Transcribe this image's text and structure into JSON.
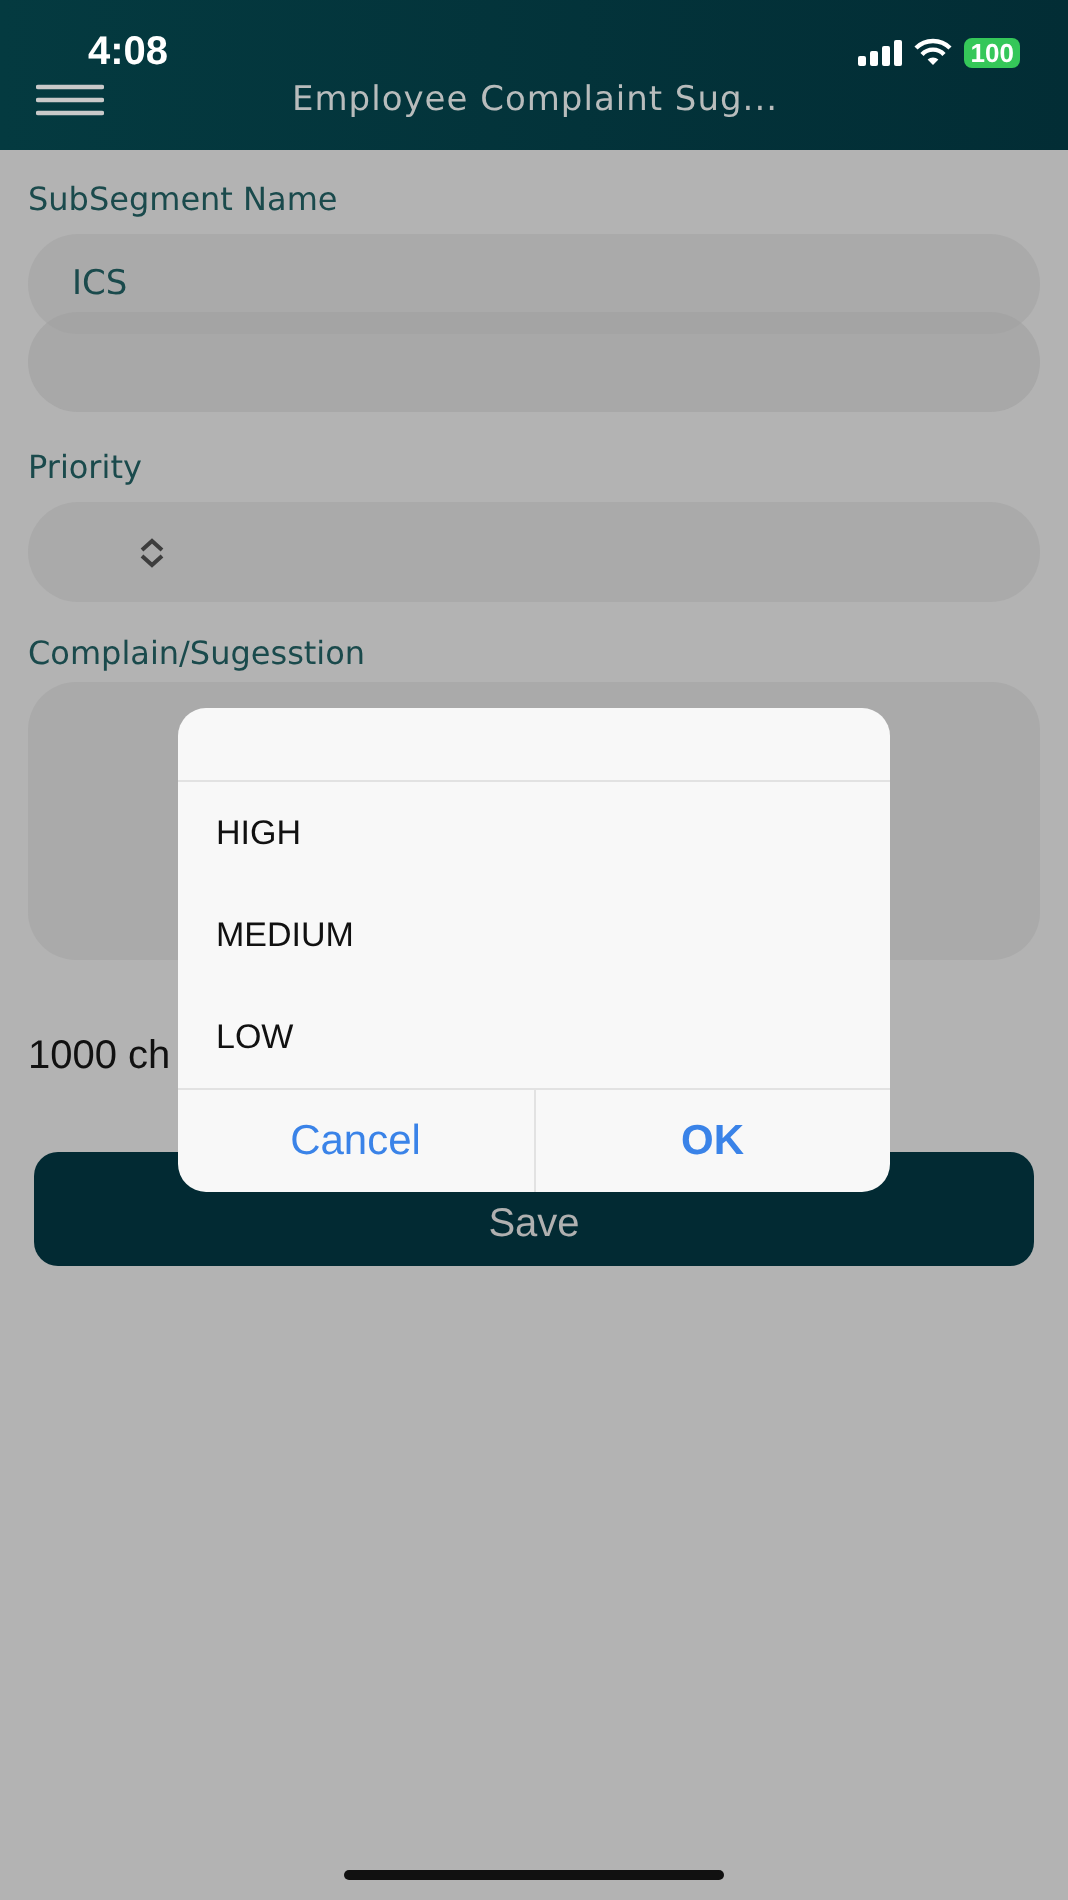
{
  "status_bar": {
    "time": "4:08",
    "battery": "100"
  },
  "header": {
    "title": "Employee Complaint Sug..."
  },
  "form": {
    "subsegment_label": "SubSegment Name",
    "subsegment_value": "ICS",
    "priority_label": "Priority",
    "complaint_label": "Complain/Sugesstion",
    "character_count": "1000 ch",
    "save_button": "Save"
  },
  "picker_dialog": {
    "options": [
      "HIGH",
      "MEDIUM",
      "LOW"
    ],
    "cancel_button": "Cancel",
    "ok_button": "OK"
  }
}
